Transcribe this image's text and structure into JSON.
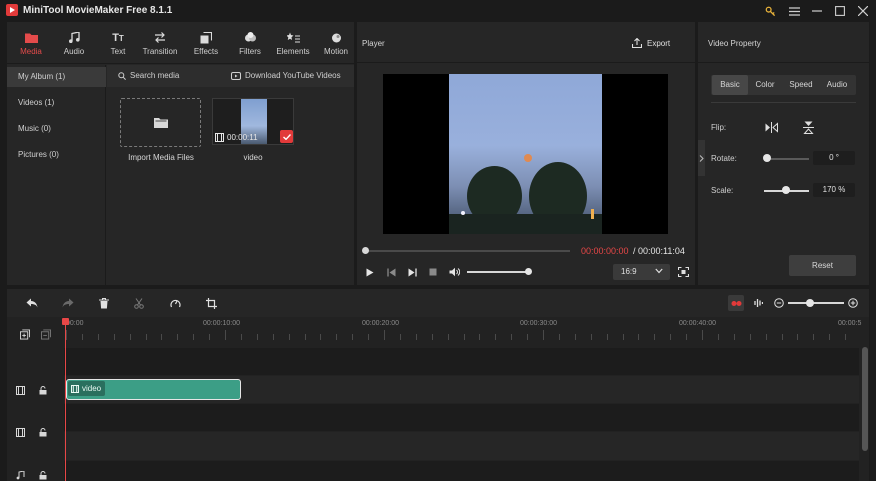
{
  "app": {
    "title": "MiniTool MovieMaker Free 8.1.1"
  },
  "toolbar": {
    "tabs": [
      {
        "label": "Media",
        "icon": "media-folder-icon"
      },
      {
        "label": "Audio",
        "icon": "music-note-icon"
      },
      {
        "label": "Text",
        "icon": "text-icon"
      },
      {
        "label": "Transition",
        "icon": "transition-icon"
      },
      {
        "label": "Effects",
        "icon": "effects-icon"
      },
      {
        "label": "Filters",
        "icon": "filters-icon"
      },
      {
        "label": "Elements",
        "icon": "elements-icon"
      },
      {
        "label": "Motion",
        "icon": "motion-icon"
      }
    ],
    "active": "Media"
  },
  "sidebar": {
    "items": [
      {
        "label": "My Album (1)"
      },
      {
        "label": "Videos (1)"
      },
      {
        "label": "Music (0)"
      },
      {
        "label": "Pictures (0)"
      }
    ]
  },
  "media": {
    "search_label": "Search media",
    "download_label": "Download YouTube Videos",
    "import_label": "Import Media Files",
    "items": [
      {
        "name": "video",
        "duration": "00:00:11"
      }
    ]
  },
  "player": {
    "title": "Player",
    "export_label": "Export",
    "time_current": "00:00:00:00",
    "time_total": "/ 00:00:11:04",
    "aspect_ratio": "16:9",
    "progress": 0,
    "volume": 1.0
  },
  "property": {
    "title": "Video Property",
    "tabs": [
      "Basic",
      "Color",
      "Speed",
      "Audio"
    ],
    "active_tab": "Basic",
    "flip_label": "Flip:",
    "rotate_label": "Rotate:",
    "rotate_value": "0 °",
    "scale_label": "Scale:",
    "scale_value": "170 %",
    "reset_label": "Reset"
  },
  "timeline": {
    "ruler_labels": [
      "00:00",
      "00:00:10:00",
      "00:00:20:00",
      "00:00:30:00",
      "00:00:40:00",
      "00:00:5"
    ],
    "clip_label": "video"
  },
  "colors": {
    "accent": "#e23a3a",
    "clip": "#3c9e86",
    "panel": "#262626",
    "background": "#1b1b1b"
  }
}
